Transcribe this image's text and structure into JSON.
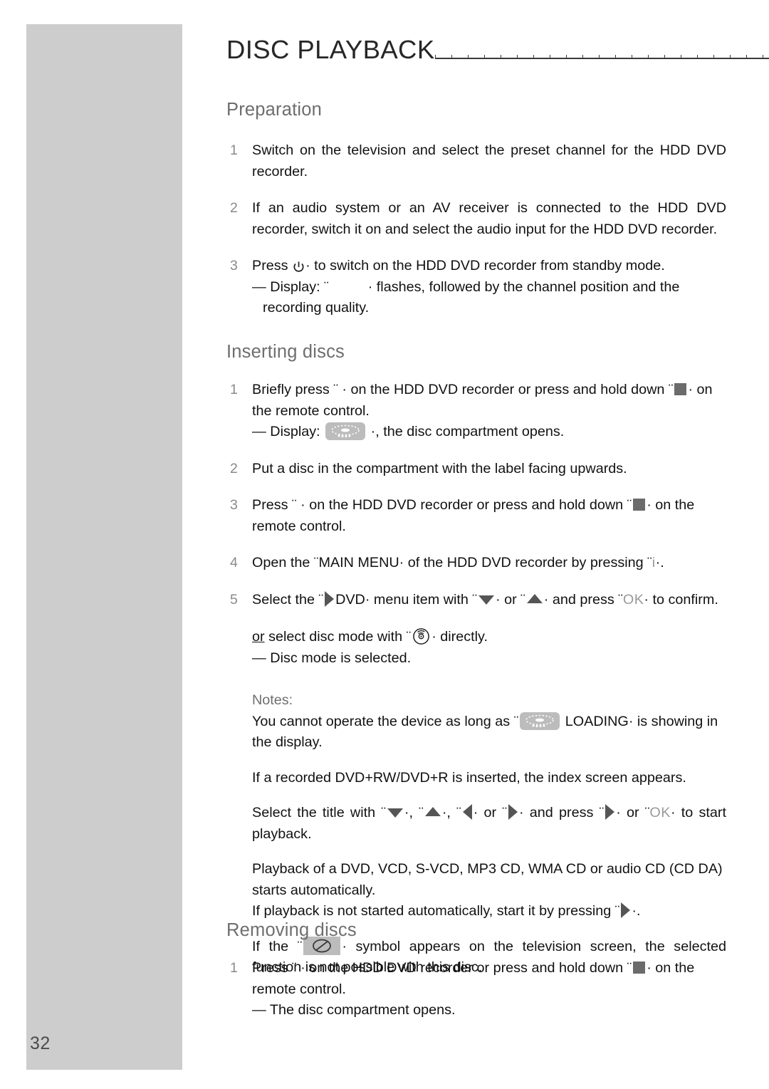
{
  "page": {
    "number": "32",
    "title": "DISC PLAYBACK"
  },
  "sections": [
    {
      "heading": "Preparation",
      "steps": [
        {
          "num": "1",
          "text": "Switch on the television and select the preset channel for the HDD DVD recorder."
        },
        {
          "num": "2",
          "text": "If an audio system or an AV receiver is connected to the HDD DVD recorder, switch it on and select the audio input for the HDD DVD recorder."
        },
        {
          "num": "3",
          "pre": "Press",
          "icon": "power-standby-icon",
          "post": "to switch on the HDD DVD recorder from standby mode.",
          "sub_pre": "— Display: ¨",
          "sub_post": "· flashes, followed by the channel position and the recording quality."
        }
      ]
    },
    {
      "heading": "Inserting discs",
      "steps": [
        {
          "num": "1",
          "t1": "Briefly press ¨ · on the HDD DVD recorder or press and hold down ¨",
          "icon1": "stop-square-icon",
          "t2": "· on the remote control.",
          "sub_pre": "— Display:",
          "icon2": "display-tray-icon",
          "sub_post": "·, the disc compartment opens."
        },
        {
          "num": "2",
          "text": "Put a disc in the compartment with the label facing upwards."
        },
        {
          "num": "3",
          "t1": "Press ¨ · on the HDD DVD recorder or press and hold down ¨",
          "icon1": "stop-square-icon",
          "t2": "· on the remote control."
        },
        {
          "num": "4",
          "text": "Open the ¨MAIN MENU· of the HDD DVD recorder by pressing ¨",
          "grey": "i",
          "text2": "·."
        },
        {
          "num": "5",
          "p1": "Select the ¨",
          "icon_play": "play-triangle-icon",
          "p2": "DVD· menu item with ¨",
          "icon_down": "arrow-down-icon",
          "p3": "· or ¨",
          "icon_up": "arrow-up-icon",
          "p4": "· and press ¨",
          "ok": "OK",
          "p5": "· to confirm.",
          "alt_pre_u": "or",
          "alt_pre": " select disc mode with ¨",
          "icon_disc": "disc-mode-icon",
          "alt_post": "· directly.",
          "alt_sub": "— Disc mode is selected."
        }
      ],
      "notes_label": "Notes:",
      "notes": [
        {
          "pre": "You cannot operate the device as long as ¨",
          "icon": "display-tray-icon",
          "post": "LOADING· is showing in the display."
        },
        {
          "text": "If a recorded DVD+RW/DVD+R is inserted, the index screen appears."
        },
        {
          "p1": "Select the title with ¨",
          "icon_down": "arrow-down-icon",
          "p2": "·, ¨",
          "icon_up": "arrow-up-icon",
          "p3": "·, ¨",
          "icon_left": "arrow-left-icon",
          "p4": "· or ¨",
          "icon_right": "arrow-right-icon",
          "p5": "· and press ¨",
          "icon_play": "play-triangle-icon",
          "p6": "· or ¨",
          "ok": "OK",
          "p7": "· to start playback."
        },
        {
          "text": "Playback of a DVD, VCD, S-VCD, MP3 CD, WMA CD or audio CD (CD DA) starts automatically."
        },
        {
          "pre": "If playback is not started automatically, start it by pressing ¨",
          "icon_play": "play-triangle-icon",
          "post": "·."
        },
        {
          "pre": "If the ¨",
          "icon": "prohibition-icon",
          "post": "· symbol appears on the television screen, the selected function is not possible with this disc."
        }
      ]
    },
    {
      "heading": "Removing discs",
      "steps": [
        {
          "num": "1",
          "t1": "Press ¨ · on the HDD DVD recorder or press and hold down ¨",
          "icon1": "stop-square-icon",
          "t2": "· on the remote control.",
          "sub": "— The disc compartment opens."
        }
      ]
    }
  ],
  "colors": {
    "sidebar": "#cdcdcd",
    "heading": "#6e6e6e",
    "body_text": "#111111",
    "step_number": "#8a8a8a",
    "glyph_grey": "#555555",
    "icon_bg": "#bcbcbc"
  }
}
